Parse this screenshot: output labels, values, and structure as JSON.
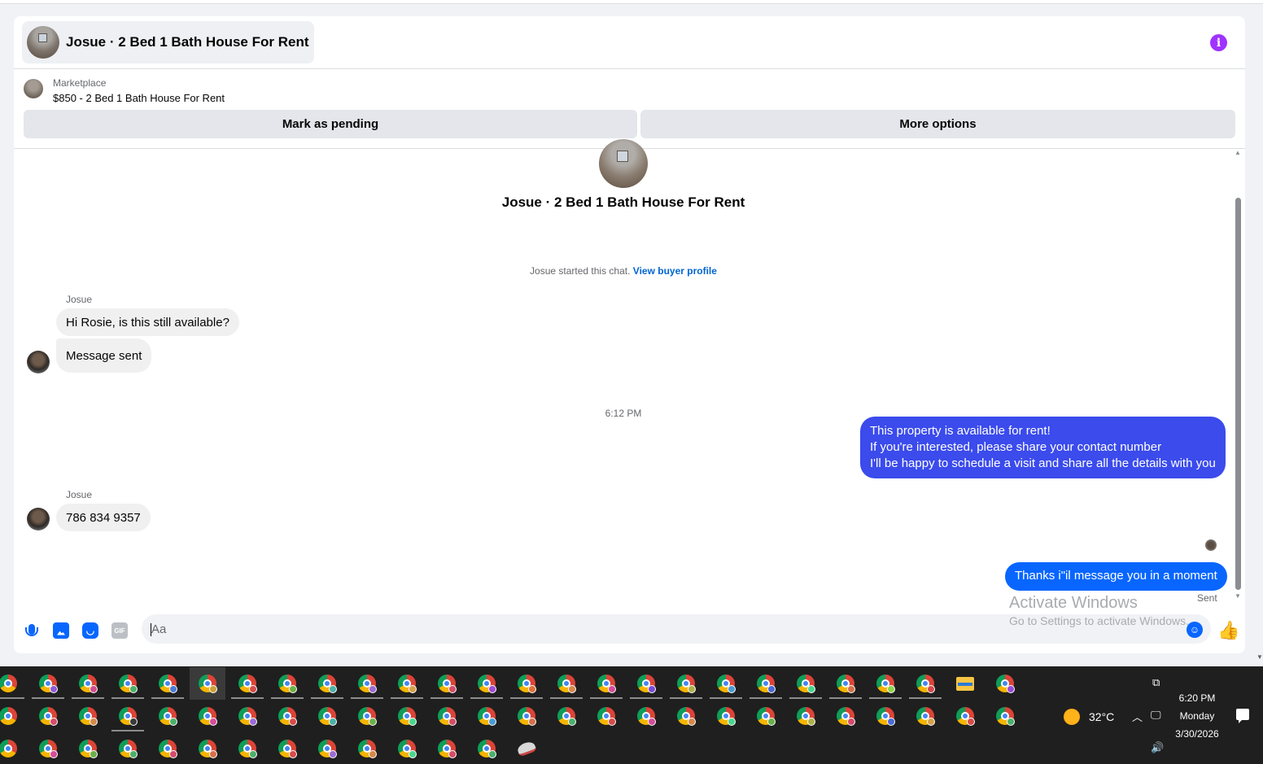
{
  "header": {
    "title": "Josue · 2 Bed 1 Bath House For Rent"
  },
  "listing": {
    "source": "Marketplace",
    "title": "$850 - 2 Bed 1 Bath House For Rent",
    "pending_button": "Mark as pending",
    "more_button": "More options"
  },
  "thread": {
    "title": "Josue · 2 Bed 1 Bath House For Rent",
    "started_text": "Josue started this chat.",
    "buyer_profile_link": "View buyer profile",
    "messages": [
      {
        "sender": "Josue",
        "text": "Hi Rosie, is this still available?",
        "direction": "incoming"
      },
      {
        "text": "Message sent",
        "direction": "incoming"
      },
      {
        "text": "6:12 PM",
        "type": "timestamp"
      },
      {
        "lines": [
          "This property is available for rent!",
          "If you're interested, please share your contact number",
          "I'll be happy to schedule a visit and share all the details with you"
        ],
        "direction": "outgoing"
      },
      {
        "sender": "Josue",
        "text": "786 834 9357",
        "direction": "incoming"
      },
      {
        "text": "Thanks i\"il message you in a moment",
        "direction": "outgoing",
        "status": "Sent"
      }
    ]
  },
  "composer": {
    "placeholder": "Aa",
    "gif_label": "GIF"
  },
  "watermark": {
    "title": "Activate Windows",
    "subtitle": "Go to Settings to activate Windows."
  },
  "taskbar": {
    "weather": "32°C",
    "time": "6:20 PM",
    "day": "Monday",
    "date": "3/30/2026"
  },
  "colors": {
    "accent": "#0866ff",
    "outgoing_gradient": "#3b4bec",
    "info": "#a033ff"
  }
}
